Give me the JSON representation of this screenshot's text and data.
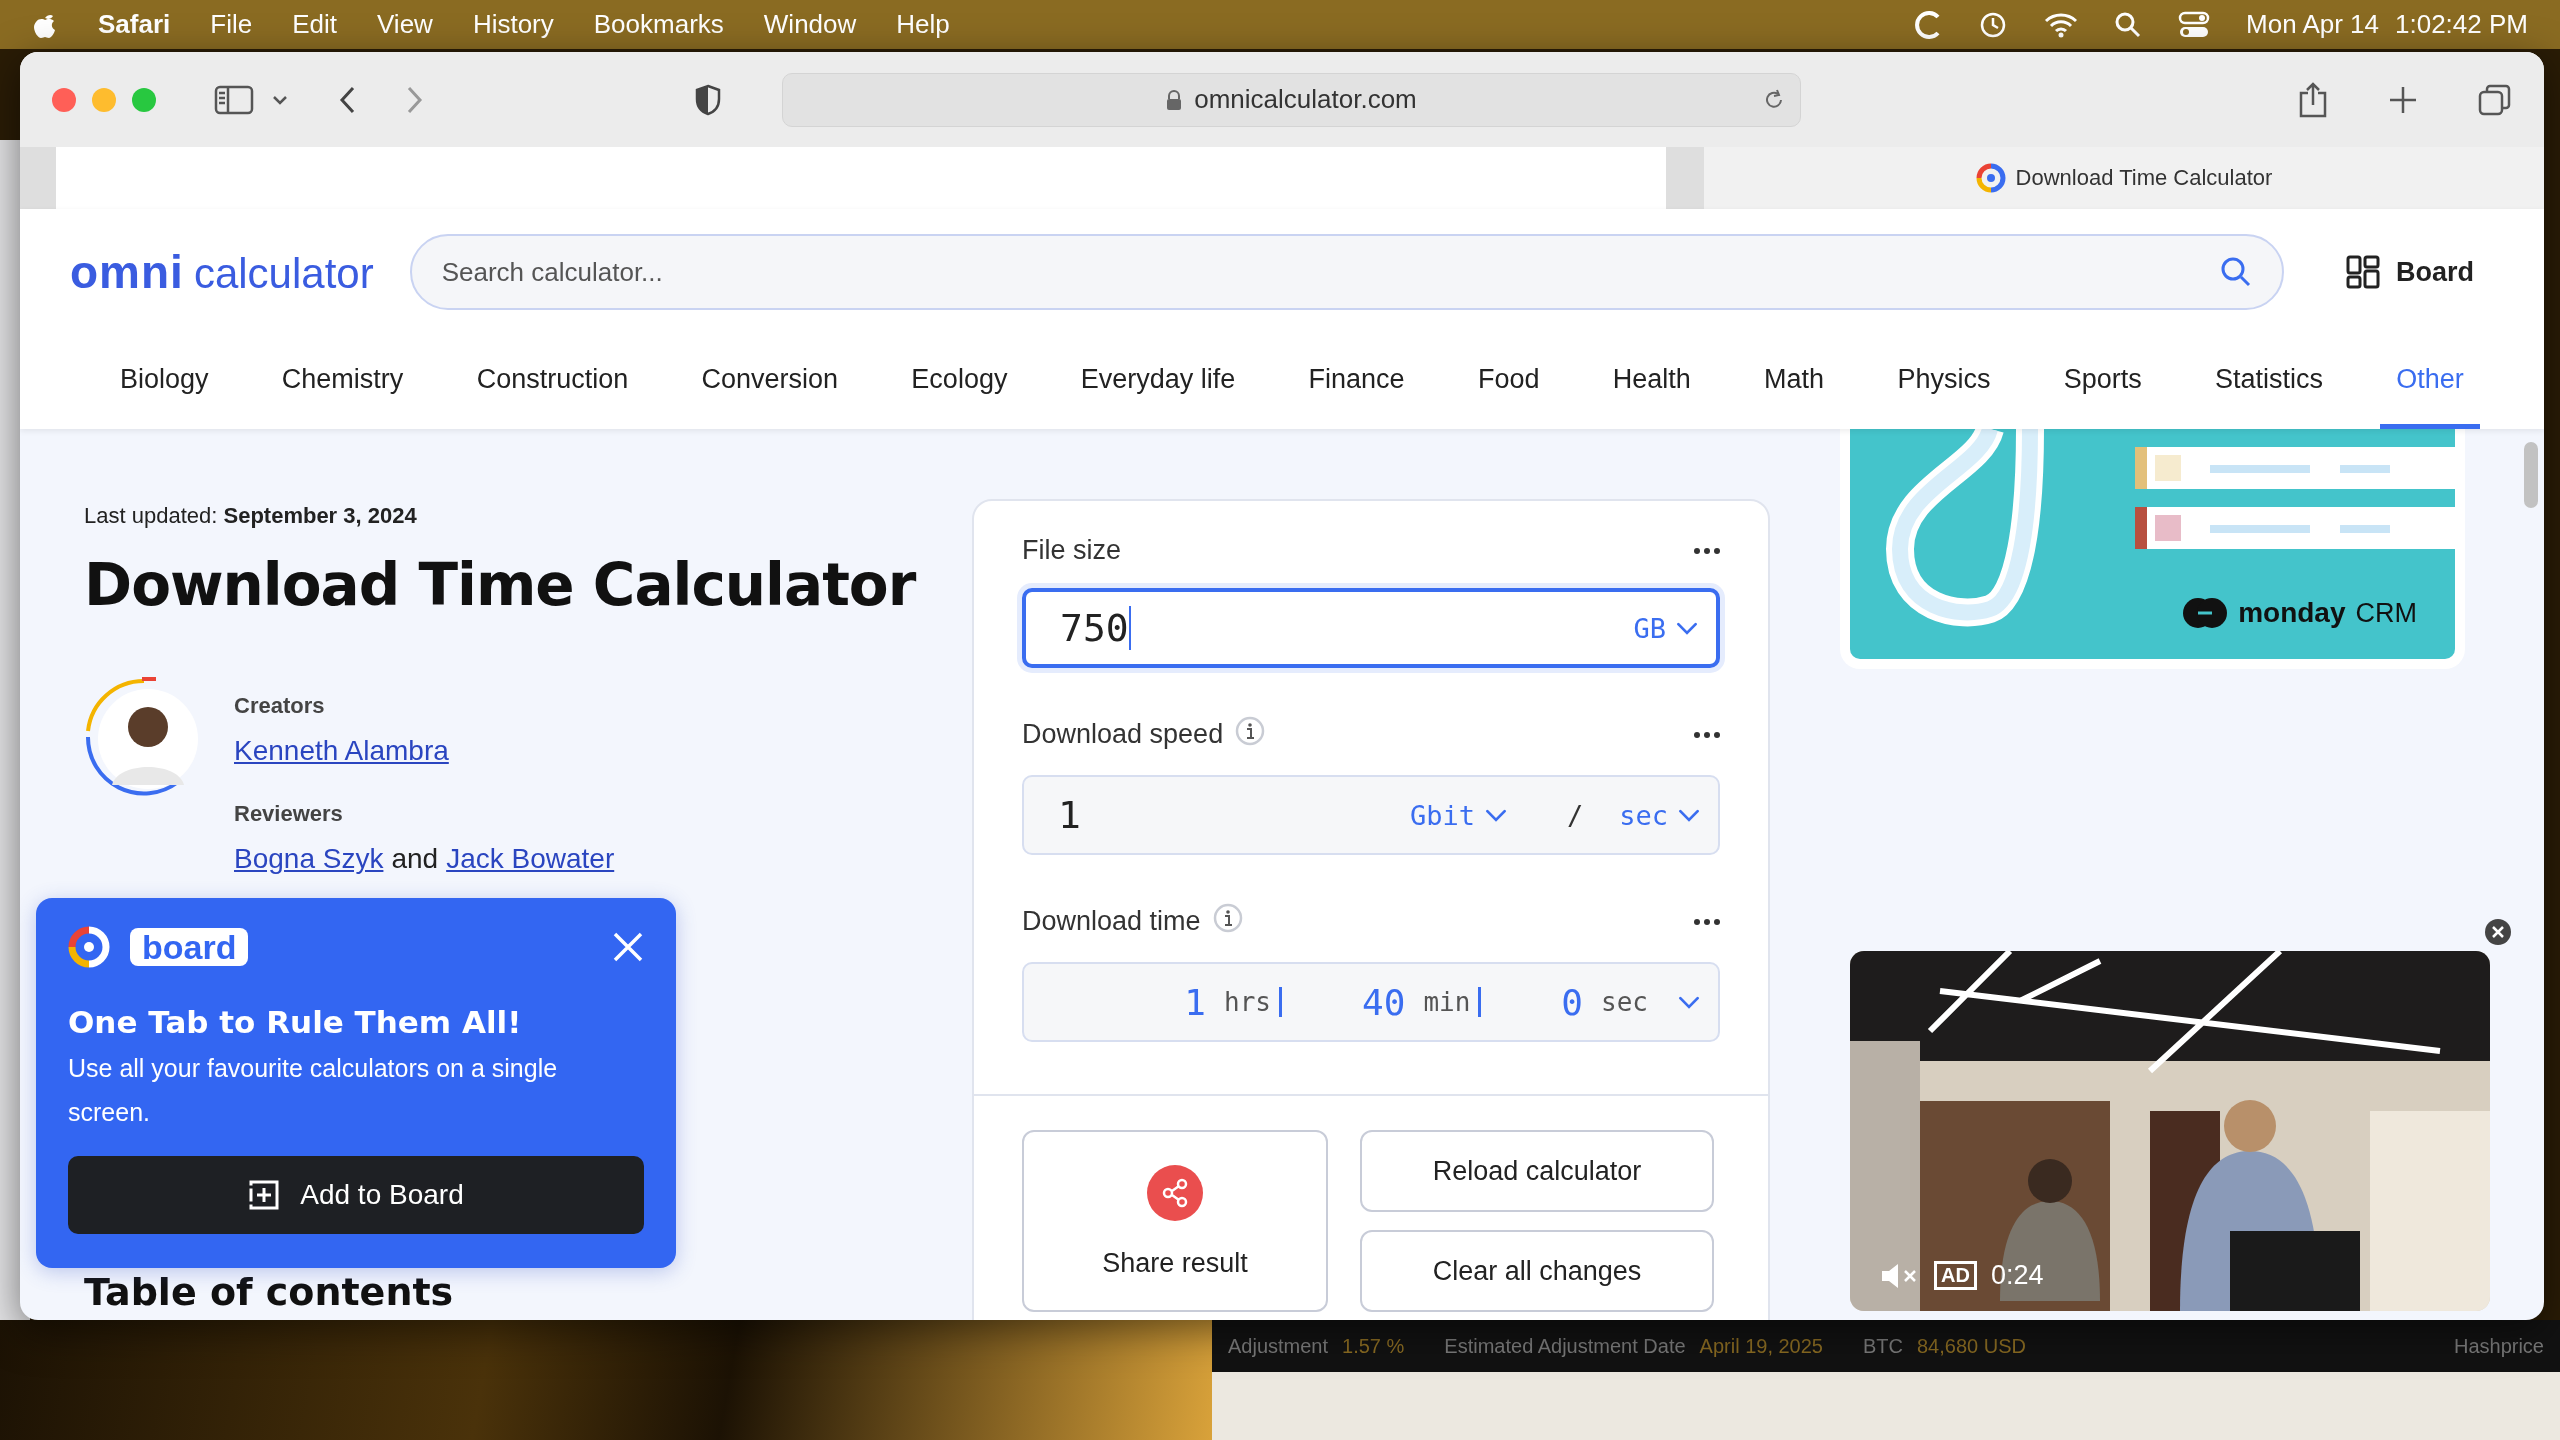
{
  "menu_bar": {
    "app": "Safari",
    "menus": [
      "File",
      "Edit",
      "View",
      "History",
      "Bookmarks",
      "Window",
      "Help"
    ],
    "date": "Mon Apr 14",
    "time": "1:02:42 PM"
  },
  "browser": {
    "url": "omnicalculator.com",
    "tab_title": "Download Time Calculator"
  },
  "site": {
    "logo_mark": "omni",
    "logo_word": "calculator",
    "search_placeholder": "Search calculator...",
    "board_label": "Board",
    "categories": [
      {
        "label": "Biology",
        "selected": false
      },
      {
        "label": "Chemistry",
        "selected": false
      },
      {
        "label": "Construction",
        "selected": false
      },
      {
        "label": "Conversion",
        "selected": false
      },
      {
        "label": "Ecology",
        "selected": false
      },
      {
        "label": "Everyday life",
        "selected": false
      },
      {
        "label": "Finance",
        "selected": false
      },
      {
        "label": "Food",
        "selected": false
      },
      {
        "label": "Health",
        "selected": false
      },
      {
        "label": "Math",
        "selected": false
      },
      {
        "label": "Physics",
        "selected": false
      },
      {
        "label": "Sports",
        "selected": false
      },
      {
        "label": "Statistics",
        "selected": false
      },
      {
        "label": "Other",
        "selected": true
      }
    ]
  },
  "article": {
    "updated_label": "Last updated:",
    "updated_date": "September 3, 2024",
    "title": "Download Time Calculator",
    "creators_label": "Creators",
    "creators": [
      "Kenneth Alambra"
    ],
    "reviewers_label": "Reviewers",
    "reviewers": [
      "Bogna Szyk",
      "Jack Bowater"
    ],
    "reviewers_joiner": "and",
    "toc_heading": "Table of contents"
  },
  "calculator": {
    "fields": [
      {
        "kind": "single",
        "label": "File size",
        "info": false,
        "focused": true,
        "value": "750",
        "unit": "GB"
      },
      {
        "kind": "rate",
        "label": "Download speed",
        "info": true,
        "focused": false,
        "value": "1",
        "unit": "Gbit",
        "separator": "/",
        "per_unit": "sec"
      },
      {
        "kind": "duration",
        "label": "Download time",
        "info": true,
        "focused": false,
        "parts": [
          {
            "value": "1",
            "unit": "hrs"
          },
          {
            "value": "40",
            "unit": "min"
          },
          {
            "value": "0",
            "unit": "sec"
          }
        ]
      }
    ],
    "share_label": "Share result",
    "buttons": [
      "Reload calculator",
      "Clear all changes"
    ]
  },
  "board_popup": {
    "brand": "board",
    "title": "One Tab to Rule Them All!",
    "text": "Use all your favourite calculators on a single screen.",
    "button": "Add to Board"
  },
  "ads": {
    "banner_brand": "monday",
    "banner_suffix": "CRM",
    "video_badge": "AD",
    "video_time": "0:24"
  },
  "background": {
    "ticker": [
      {
        "label": "Adjustment",
        "value": "1.57 %"
      },
      {
        "label": "Estimated Adjustment Date",
        "value": "April 19, 2025"
      },
      {
        "label": "BTC",
        "value": "84,680 USD"
      },
      {
        "label": "Hashprice"
      }
    ]
  }
}
